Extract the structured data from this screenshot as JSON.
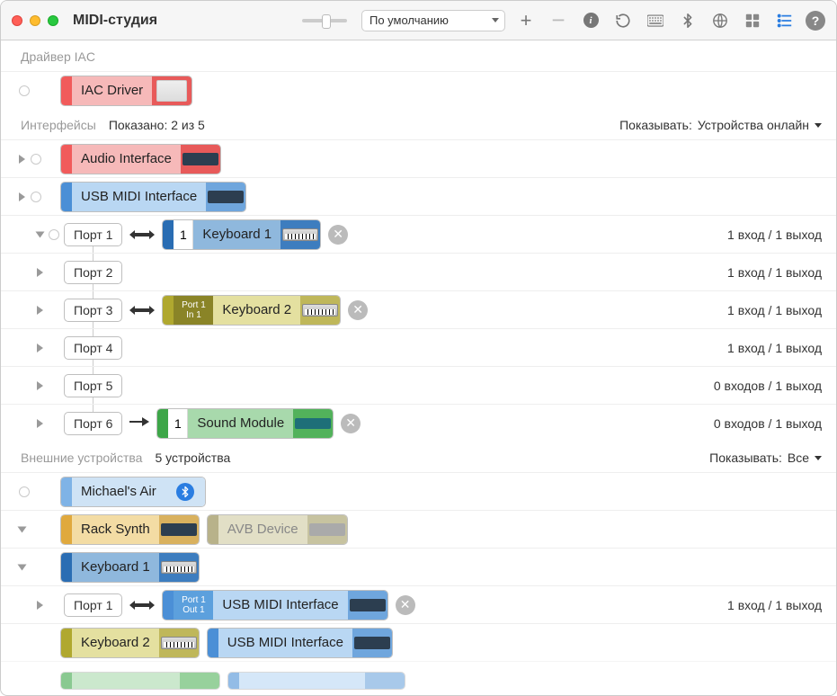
{
  "window": {
    "title": "MIDI-студия"
  },
  "toolbar": {
    "config_label": "По умолчанию"
  },
  "sections": {
    "iac": {
      "label": "Драйвер IAC",
      "device": "IAC Driver"
    },
    "interfaces": {
      "label": "Интерфейсы",
      "shown": "Показано: 2 из 5",
      "show_label": "Показывать:",
      "show_value": "Устройства онлайн"
    },
    "external": {
      "label": "Внешние устройства",
      "count": "5 устройства",
      "show_label": "Показывать:",
      "show_value": "Все"
    }
  },
  "devices": {
    "audio_if": "Audio Interface",
    "usb_midi": "USB MIDI Interface",
    "keyboard1": "Keyboard 1",
    "keyboard2": "Keyboard 2",
    "sound_module": "Sound Module",
    "michaels_air": "Michael's Air",
    "rack_synth": "Rack Synth",
    "avb_device": "AVB Device"
  },
  "ports": {
    "p1": "Порт 1",
    "p2": "Порт 2",
    "p3": "Порт 3",
    "p4": "Порт 4",
    "p5": "Порт 5",
    "p6": "Порт 6",
    "num1": "1",
    "port1_label": "Port 1",
    "in1": "In 1",
    "out1": "Out 1"
  },
  "io": {
    "one_one": "1 вход / 1 выход",
    "zero_one": "0 входов / 1 выход"
  }
}
